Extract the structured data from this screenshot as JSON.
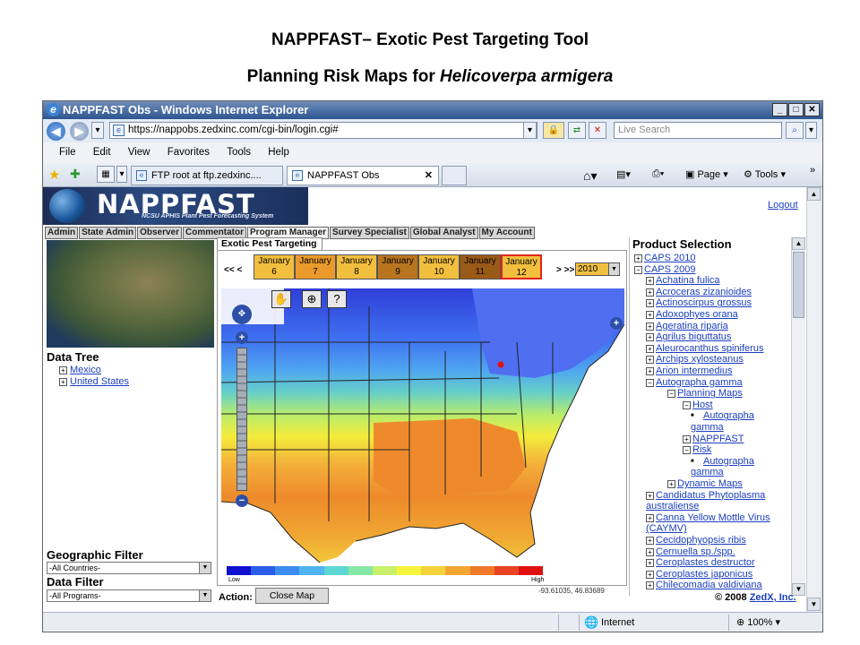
{
  "slide": {
    "title": "NAPPFAST– Exotic Pest Targeting Tool",
    "subtitle_prefix": "Planning Risk Maps for ",
    "subtitle_species": "Helicoverpa armigera"
  },
  "browser": {
    "window_title": "NAPPFAST Obs - Windows Internet Explorer",
    "url": "https://nappobs.zedxinc.com/cgi-bin/login.cgi#",
    "search_placeholder": "Live Search",
    "menu": [
      "File",
      "Edit",
      "View",
      "Favorites",
      "Tools",
      "Help"
    ],
    "tabs": [
      {
        "label": "FTP root at ftp.zedxinc....",
        "active": false
      },
      {
        "label": "NAPPFAST Obs",
        "active": true
      }
    ],
    "toolbar_right": {
      "page": "Page",
      "tools": "Tools"
    },
    "status": {
      "zone": "Internet",
      "zoom": "100%"
    }
  },
  "app": {
    "brand": "NAPPFAST",
    "brand_sub": "NCSU APHIS Plant Pest Forecasting System",
    "logout": "Logout",
    "nav_tabs": [
      "Admin",
      "State Admin",
      "Observer",
      "Commentator",
      "Program Manager",
      "Survey Specialist",
      "Global Analyst",
      "My Account"
    ],
    "active_nav": "Program Manager",
    "left": {
      "data_tree_title": "Data Tree",
      "tree": [
        "Mexico",
        "United States"
      ],
      "geo_filter_title": "Geographic Filter",
      "geo_filter_value": "-All Countries-",
      "data_filter_title": "Data Filter",
      "data_filter_value": "-All Programs-"
    },
    "map_panel": {
      "tab": "Exotic Pest Targeting",
      "prev": "<< <",
      "next": "> >>",
      "year": "2010",
      "months": [
        {
          "month": "January",
          "day": "6",
          "color": "#f2be3e",
          "selected": false
        },
        {
          "month": "January",
          "day": "7",
          "color": "#e99a2a",
          "selected": false
        },
        {
          "month": "January",
          "day": "8",
          "color": "#f2be3e",
          "selected": false
        },
        {
          "month": "January",
          "day": "9",
          "color": "#b8741f",
          "selected": false
        },
        {
          "month": "January",
          "day": "10",
          "color": "#f2be3e",
          "selected": false
        },
        {
          "month": "January",
          "day": "11",
          "color": "#9a5a18",
          "selected": false
        },
        {
          "month": "January",
          "day": "12",
          "color": "#f2be3e",
          "selected": true
        }
      ],
      "legend_low": "Low",
      "legend_high": "High",
      "legend_colors": [
        "#1010d0",
        "#2a5ee8",
        "#3d8cf0",
        "#4fb4f0",
        "#5ed6d6",
        "#86e8a4",
        "#c8f06a",
        "#f4f43c",
        "#f4d23a",
        "#f2a632",
        "#ee7a2a",
        "#e84424",
        "#e01010"
      ],
      "coords": "-93.61035, 46.83689",
      "action_label": "Action:",
      "close_button": "Close Map"
    },
    "product_selection": {
      "title": "Product Selection",
      "items": [
        {
          "text": "CAPS 2010",
          "level": 0,
          "mark": "+"
        },
        {
          "text": "CAPS 2009",
          "level": 0,
          "mark": "−"
        },
        {
          "text": "Achatina fulica",
          "level": 1,
          "mark": "+"
        },
        {
          "text": "Acroceras zizanioides",
          "level": 1,
          "mark": "+"
        },
        {
          "text": "Actinoscirpus grossus",
          "level": 1,
          "mark": "+"
        },
        {
          "text": "Adoxophyes orana",
          "level": 1,
          "mark": "+"
        },
        {
          "text": "Ageratina riparia",
          "level": 1,
          "mark": "+"
        },
        {
          "text": "Agrilus biguttatus",
          "level": 1,
          "mark": "+"
        },
        {
          "text": "Aleurocanthus spiniferus",
          "level": 1,
          "mark": "+"
        },
        {
          "text": "Archips xylosteanus",
          "level": 1,
          "mark": "+"
        },
        {
          "text": "Arion intermedius",
          "level": 1,
          "mark": "+"
        },
        {
          "text": "Autographa gamma",
          "level": 1,
          "mark": "−"
        },
        {
          "text": "Planning Maps",
          "level": 2,
          "mark": "−"
        },
        {
          "text": "Host",
          "level": 3,
          "mark": "−"
        },
        {
          "text": "Autographa",
          "level": 4,
          "mark": "•"
        },
        {
          "text": "gamma",
          "level": 5,
          "mark": ""
        },
        {
          "text": "NAPPFAST",
          "level": 3,
          "mark": "+"
        },
        {
          "text": "Risk",
          "level": 3,
          "mark": "−"
        },
        {
          "text": "Autographa",
          "level": 4,
          "mark": "•"
        },
        {
          "text": "gamma",
          "level": 5,
          "mark": ""
        },
        {
          "text": "Dynamic Maps",
          "level": 2,
          "mark": "+"
        },
        {
          "text": "Candidatus Phytoplasma",
          "level": 1,
          "mark": "+"
        },
        {
          "text": "australiense",
          "level": 0.5,
          "mark": ""
        },
        {
          "text": "Canna Yellow Mottle Virus",
          "level": 1,
          "mark": "+"
        },
        {
          "text": "(CAYMV)",
          "level": 0.5,
          "mark": ""
        },
        {
          "text": "Cecidophyopsis ribis",
          "level": 1,
          "mark": "+"
        },
        {
          "text": "Cernuella sp./spp.",
          "level": 1,
          "mark": "+"
        },
        {
          "text": "Ceroplastes destructor",
          "level": 1,
          "mark": "+"
        },
        {
          "text": "Ceroplastes japonicus",
          "level": 1,
          "mark": "+"
        },
        {
          "text": "Chilecomadia valdiviana",
          "level": 1,
          "mark": "+"
        }
      ]
    },
    "copyright_prefix": "© 2008 ",
    "copyright_link": "ZedX, Inc."
  }
}
